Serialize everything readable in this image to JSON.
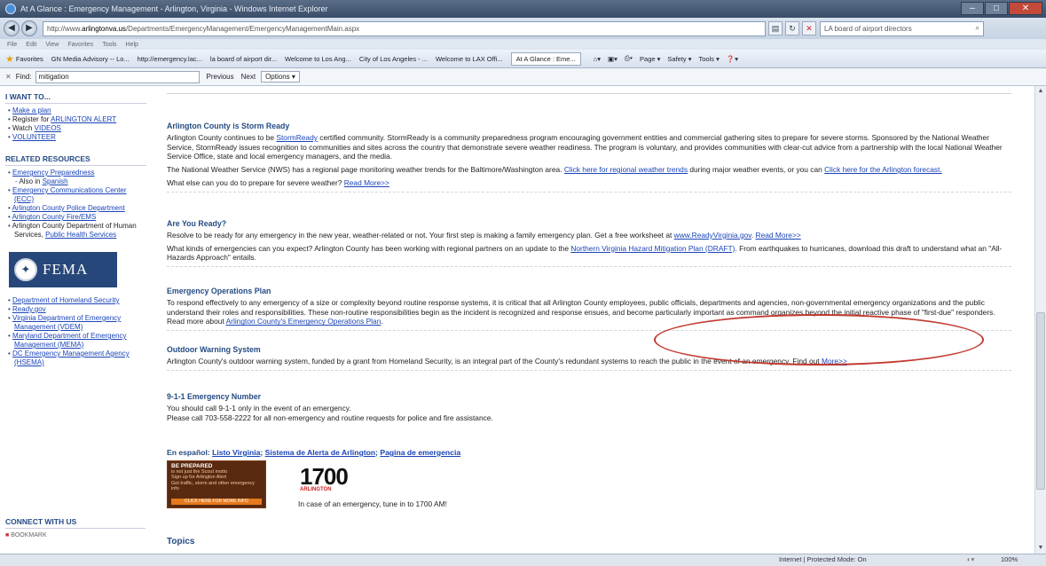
{
  "window": {
    "title": "At A Glance : Emergency Management - Arlington, Virginia - Windows Internet Explorer",
    "controls": [
      "–",
      "□",
      "✕"
    ]
  },
  "address": {
    "url_prefix": "http://www.",
    "url_domain": "arlingtonva.us",
    "url_path": "/Departments/EmergencyManagement/EmergencyManagementMain.aspx",
    "search_value": "LA board of airport directors"
  },
  "menu": [
    "File",
    "Edit",
    "View",
    "Favorites",
    "Tools",
    "Help"
  ],
  "favorites": {
    "label": "Favorites",
    "items": [
      "GN Media Advisory -- Lo...",
      "http://emergency.lac...",
      "la board of airport dir...",
      "Welcome to Los Ang...",
      "City of Los Angeles - ...",
      "Welcome to LAX Offi..."
    ],
    "current_tab": "At A Glance : Eme...",
    "commands": [
      "Page ▾",
      "Safety ▾",
      "Tools ▾",
      "❓▾"
    ]
  },
  "find": {
    "label": "Find:",
    "value": "mitigation",
    "previous": "Previous",
    "next": "Next",
    "options": "Options ▾"
  },
  "sidebar": {
    "i_want_heading": "I WANT TO...",
    "i_want": [
      {
        "text": "Make a plan",
        "link": true
      },
      {
        "pre": "Register for ",
        "link_text": "ARLINGTON ALERT"
      },
      {
        "pre": "Watch ",
        "link_text": "VIDEOS"
      },
      {
        "text": "VOLUNTEER",
        "link": true
      }
    ],
    "related_heading": "RELATED RESOURCES",
    "related": [
      {
        "text": "Emergency Preparedness",
        "link": true
      },
      {
        "sub": true,
        "pre": "Also in ",
        "link_text": "Spanish"
      },
      {
        "text": "Emergency Communications Center (ECC)",
        "link": true
      },
      {
        "text": "Arlington County Police Department",
        "link": true
      },
      {
        "text": "Arlington County Fire/EMS",
        "link": true
      },
      {
        "pre": "Arlington County Department of Human Services, ",
        "link_text": "Public Health Services"
      }
    ],
    "fema_text": "FEMA",
    "gov_links": [
      "Department of Homeland Security",
      "Ready.gov",
      "Virginia Department of Emergency Management (VDEM)",
      "Maryland Department of Emergency Management (MEMA)",
      "DC Emergency Management Agency (HSEMA)"
    ],
    "connect_heading": "CONNECT WITH US",
    "share_label": "BOOKMARK"
  },
  "main": {
    "storm": {
      "heading": "Arlington County is Storm Ready",
      "p1_a": "Arlington County continues to be ",
      "p1_link": "StormReady",
      "p1_b": " certified community.  StormReady is a community preparedness program encouraging government entities and commercial gathering sites to prepare for severe storms.  Sponsored by the National Weather Service, StormReady issues recognition to communities and sites across the country that demonstrate severe weather readiness.  The program is voluntary, and provides communities with clear-cut advice from a partnership with the local National Weather Service Office, state and local emergency managers, and the media.",
      "p2_a": "The National Weather Service (NWS) has a regional page monitoring weather trends for the Baltimore/Washington area.  ",
      "p2_link1": "Click here for regional weather trends",
      "p2_b": " during major weather events, or you can ",
      "p2_link2": "Click here for the Arlington forecast.",
      "p3_a": "What else can you do to prepare for severe weather?  ",
      "p3_link": "Read More>>"
    },
    "ready": {
      "heading": "Are You Ready?",
      "p1_a": "Resolve to be ready for any emergency in the new year, weather-related or not.  Your first step is making a family emergency plan.  Get a free worksheet at ",
      "p1_link1": "www.ReadyVirginia.gov",
      "p1_b": ".  ",
      "p1_link2": "Read More>>",
      "p2_a": "What kinds of emergencies can you expect?  Arlington County has been working with regional partners on an update to the ",
      "p2_link": "Northern Virginia Hazard Mitigation Plan (DRAFT)",
      "p2_b": ".  From earthquakes to hurricanes, download this draft to understand what an \"All-Hazards Approach\" entails."
    },
    "eop": {
      "heading": "Emergency Operations Plan",
      "p1_a": "To respond effectively to any emergency of a size or complexity beyond routine response systems, it is critical that all Arlington County employees, public officials, departments and agencies, non-governmental emergency organizations and the public understand their roles and responsibilities. These non-routine responsibilities begin as the incident is recognized and response ensues, and become particularly important as command organizes beyond the initial reactive phase of \"first-due\" responders. Read more about ",
      "p1_link": "Arlington County's Emergency Operations Plan",
      "p1_b": "."
    },
    "ows": {
      "heading": "Outdoor Warning System",
      "p1_a": "Arlington County's outdoor warning system, funded by a grant from Homeland Security, is an integral part of the County's redundant systems to reach the public in the event of an emergency. Find out ",
      "p1_link": "More>>"
    },
    "e911": {
      "heading": "9-1-1 Emergency Number",
      "p1": "You should call 9-1-1 only in the event of an emergency.",
      "p2": "Please call 703-558-2222 for all non-emergency and routine requests for police and fire assistance."
    },
    "espanol": {
      "label": "En español: ",
      "link1": "Listo Virginia",
      "link2": "Sistema de Alerta de Arlington",
      "link3": "Pagina de emergencia",
      "sep": "; "
    },
    "banner": {
      "line1": "BE PREPARED",
      "line2": "is not just the Scout motto",
      "line3": "Sign up for Arlington Alert",
      "line4": "Get traffic, storm and other emergency info",
      "button": "CLICK HERE FOR MORE INFO"
    },
    "am": {
      "number": "1700",
      "sub": "ARLINGTON",
      "text": "In case of an emergency, tune in to 1700 AM!"
    },
    "topics": "Topics"
  },
  "status": {
    "zone": "Internet | Protected Mode: On",
    "zoom": "100%"
  }
}
